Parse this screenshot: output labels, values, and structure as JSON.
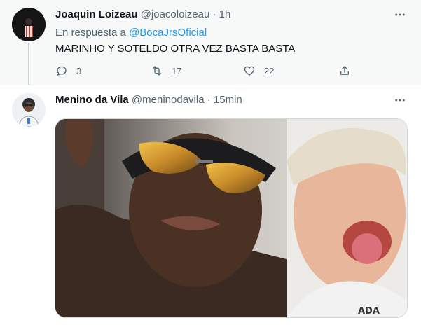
{
  "colors": {
    "accent": "#1d9bf0",
    "secondary_text": "#536471",
    "primary_text": "#0f1419",
    "focused_bg": "#f7f9f9"
  },
  "tweets": [
    {
      "name": "Joaquin Loizeau",
      "handle": "@joacoloizeau",
      "separator": "·",
      "time": "1h",
      "reply_prefix": "En respuesta a",
      "reply_to": "@BocaJrsOficial",
      "text": "MARINHO Y SOTELDO OTRA VEZ BASTA BASTA",
      "actions": {
        "replies": "3",
        "retweets": "17",
        "likes": "22"
      },
      "icons": [
        "reply-icon",
        "retweet-icon",
        "like-icon",
        "share-icon",
        "more-icon"
      ]
    },
    {
      "name": "Menino da Vila",
      "handle": "@meninodavila",
      "separator": "·",
      "time": "15min",
      "media": "photo of two men taking a selfie",
      "icons": [
        "more-icon"
      ]
    }
  ]
}
